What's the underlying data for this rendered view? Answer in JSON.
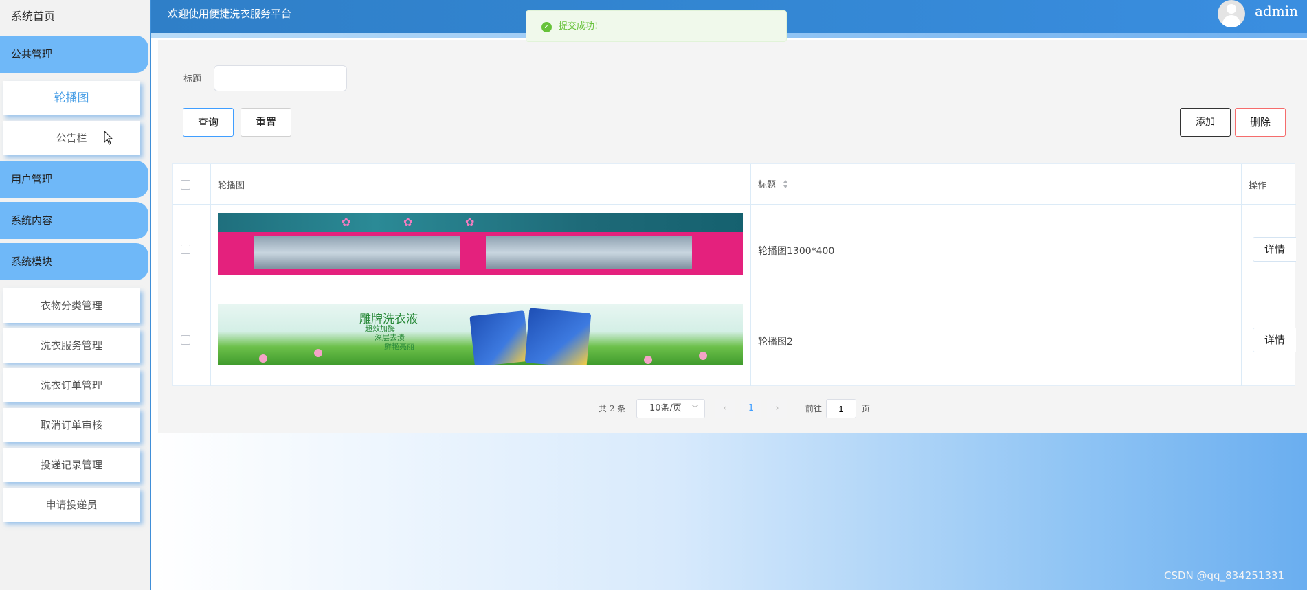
{
  "sidebar": {
    "home": "系统首页",
    "groups": {
      "public": "公共管理",
      "users": "用户管理",
      "content": "系统内容",
      "modules": "系统模块"
    },
    "public_items": [
      "轮播图",
      "公告栏"
    ],
    "module_items": [
      "衣物分类管理",
      "洗衣服务管理",
      "洗衣订单管理",
      "取消订单审核",
      "投递记录管理",
      "申请投递员"
    ]
  },
  "header": {
    "title": "欢迎使用便捷洗衣服务平台",
    "username": "admin"
  },
  "toast": {
    "message": "提交成功!",
    "icon": "success-check-icon"
  },
  "search": {
    "label": "标题",
    "value": "",
    "placeholder": ""
  },
  "toolbar": {
    "query": "查询",
    "reset": "重置",
    "add": "添加",
    "delete": "删除"
  },
  "table": {
    "headers": {
      "image": "轮播图",
      "title": "标题",
      "actions": "操作"
    },
    "rows": [
      {
        "title": "轮播图1300*400",
        "action": "详情"
      },
      {
        "title": "轮播图2",
        "action": "详情"
      }
    ]
  },
  "banners": {
    "second_heading": "雕牌洗衣液",
    "second_lines": [
      "超效加酶",
      "深层去渍",
      "鲜艳亮丽"
    ]
  },
  "pagination": {
    "total": "共 2 条",
    "page_size": "10条/页",
    "current": "1",
    "goto_label": "前往",
    "goto_value": "1",
    "unit": "页"
  },
  "watermark": "CSDN @qq_834251331",
  "colors": {
    "accent": "#409eff",
    "header": "#2f7fc8",
    "sidebar_group": "#6fb8f8",
    "success": "#67c23a",
    "danger": "#f56c6c"
  }
}
